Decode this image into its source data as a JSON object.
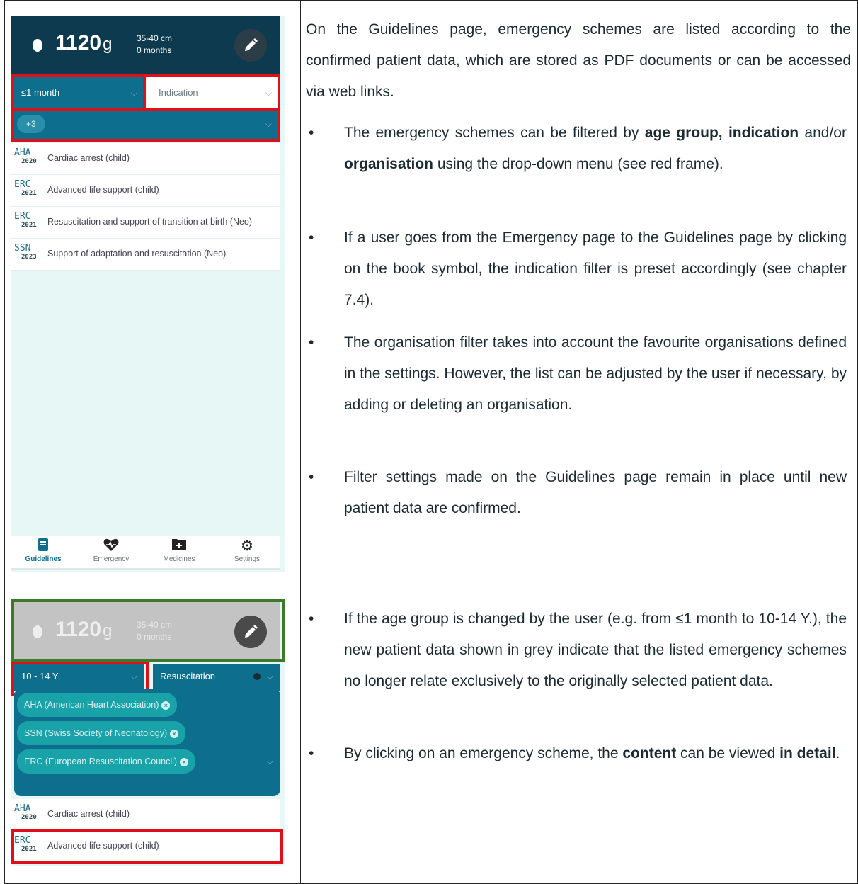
{
  "phone1": {
    "weight": "1120",
    "unit": "g",
    "length": "35-40 cm",
    "age": "0 months",
    "age_filter": "≤1 month",
    "indication_placeholder": "Indication",
    "org_chip": "+3",
    "schemes": [
      {
        "org": "AHA",
        "year": "2020",
        "title": "Cardiac arrest (child)"
      },
      {
        "org": "ERC",
        "year": "2021",
        "title": "Advanced life support (child)"
      },
      {
        "org": "ERC",
        "year": "2021",
        "title": "Resuscitation and support of transition at birth (Neo)"
      },
      {
        "org": "SSN",
        "year": "2023",
        "title": "Support of adaptation and resuscitation (Neo)"
      }
    ],
    "nav": [
      {
        "label": "Guidelines",
        "icon": "book-icon"
      },
      {
        "label": "Emergency",
        "icon": "heart-pulse-icon"
      },
      {
        "label": "Medicines",
        "icon": "medical-folder-icon"
      },
      {
        "label": "Settings",
        "icon": "gear-icon"
      }
    ]
  },
  "phone2": {
    "weight": "1120",
    "unit": "g",
    "length": "35-40 cm",
    "age": "0 months",
    "age_filter": "10 - 14 Y",
    "indication": "Resuscitation",
    "orgs": [
      "AHA (American Heart Association)",
      "SSN (Swiss Society of Neonatology)",
      "ERC (European Resuscitation Council)"
    ],
    "schemes": [
      {
        "org": "AHA",
        "year": "2020",
        "title": "Cardiac arrest (child)"
      },
      {
        "org": "ERC",
        "year": "2021",
        "title": "Advanced life support (child)"
      }
    ]
  },
  "text1": {
    "intro": "On the Guidelines page, emergency schemes are listed according to the confirmed patient data, which are stored as PDF documents or can be accessed via web links.",
    "b1_pre": "The emergency schemes can be filtered by ",
    "b1_age": "age group,",
    "b1_ind": "indication",
    "b1_mid": " and/or ",
    "b1_org": "organisation",
    "b1_post": " using the drop-down menu (see red frame).",
    "b2": "If a user goes from the Emergency page to the Guidelines page by clicking on the book symbol, the indication filter is preset accordingly (see chapter 7.4).",
    "b3": "The organisation filter takes into account the favourite organisations defined in the settings. However, the list can be adjusted by the user if necessary, by adding or deleting an organisation.",
    "b4": "Filter settings made on the Guidelines page remain in place until new patient data are confirmed."
  },
  "text2": {
    "b1": "If the age group is changed by the user (e.g. from ≤1 month to 10-14 Y.), the new patient data shown in grey indicate that the listed emergency schemes no longer relate exclusively to the originally selected patient data.",
    "b2_pre": "By clicking on an emergency scheme, the ",
    "b2_content": "content",
    "b2_mid": " can be viewed ",
    "b2_detail": "in detail",
    "b2_post": "."
  },
  "colors": {
    "header": "#0d3a4e",
    "accent": "#0d6f8d",
    "frame_red": "#e0101a",
    "frame_green": "#3a7a2a"
  }
}
